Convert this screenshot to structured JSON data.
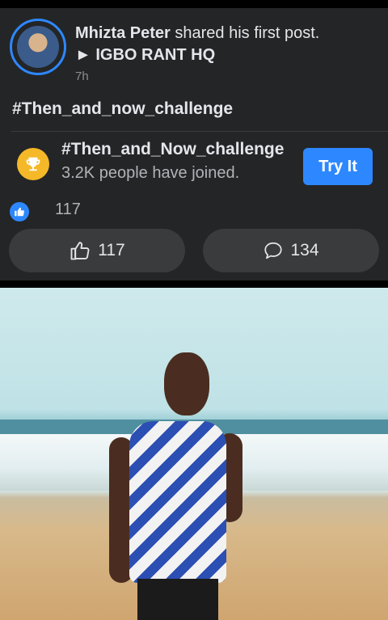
{
  "post": {
    "author": "Mhizta Peter",
    "action_text": "shared his first post.",
    "arrow": "►",
    "group": "IGBO RANT HQ",
    "time": "7h",
    "hashtag": "#Then_and_now_challenge"
  },
  "challenge": {
    "title": "#Then_and_Now_challenge",
    "subtitle": "3.2K people have joined.",
    "button_label": "Try It",
    "icon": "trophy-icon"
  },
  "reactions": {
    "count": "117"
  },
  "actions": {
    "like_count": "117",
    "comment_count": "134"
  },
  "colors": {
    "accent": "#2d88ff",
    "card_bg": "#242526",
    "trophy": "#f5b829"
  }
}
